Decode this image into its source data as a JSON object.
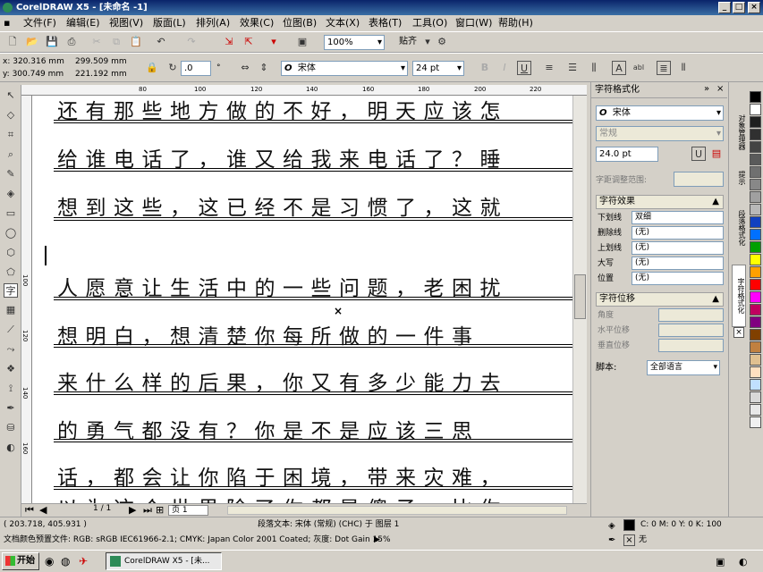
{
  "window": {
    "title": "CorelDRAW X5 - [未命名 -1]"
  },
  "menu": [
    "文件(F)",
    "编辑(E)",
    "视图(V)",
    "版面(L)",
    "排列(A)",
    "效果(C)",
    "位图(B)",
    "文本(X)",
    "表格(T)",
    "工具(O)",
    "窗口(W)",
    "帮助(H)"
  ],
  "toolbar": {
    "zoom": "100%",
    "snap_label": "贴齐"
  },
  "propbar": {
    "x": "x: 320.316 mm",
    "y": "y: 300.749 mm",
    "w": "299.509 mm",
    "h": "221.192 mm",
    "angle": ".0",
    "angle_unit": "°",
    "font": "宋体",
    "size": "24 pt",
    "italic_label": "I",
    "underline_label": "U",
    "align_label": "abl"
  },
  "canvas": {
    "lines": [
      "还有那些地方做的不好，明天应该怎",
      "给谁电话了，谁又给我来电话了？睡",
      "想到这些，这已经不是习惯了，这就",
      "",
      "人愿意让生活中的一些问题，老困扰",
      "想明白，想清楚你每所做的一件事",
      "来什么样的后果，你又有多少能力去",
      "的勇气都没有？你是不是应该三思",
      "话，都会让你陷于困境，带来灾难，",
      "以为这个世界除了你都是傻子，比你"
    ],
    "ruler_h": [
      "80",
      "100",
      "120",
      "140",
      "160",
      "180",
      "200",
      "220"
    ],
    "ruler_v": [
      "100",
      "120",
      "140",
      "160"
    ],
    "page_nav": "1 / 1",
    "page_tab": "页 1"
  },
  "docker": {
    "title": "字符格式化",
    "font": "宋体",
    "style": "常规",
    "size": "24.0 pt",
    "kerning_label": "字距调整范围:",
    "effects_title": "字符效果",
    "effects": [
      {
        "k": "下划线",
        "v": "双细"
      },
      {
        "k": "删除线",
        "v": "(无)"
      },
      {
        "k": "上划线",
        "v": "(无)"
      },
      {
        "k": "大写",
        "v": "(无)"
      },
      {
        "k": "位置",
        "v": "(无)"
      }
    ],
    "shift_title": "字符位移",
    "shift": [
      {
        "k": "角度"
      },
      {
        "k": "水平位移"
      },
      {
        "k": "垂直位移"
      }
    ],
    "script_label": "脚本:",
    "script_value": "全部语言"
  },
  "side_tabs": [
    "对象管理器",
    "提示",
    "段落格式化",
    "字符格式化"
  ],
  "palette": [
    "#000000",
    "#ffffff",
    "#1f1f1f",
    "#303030",
    "#444444",
    "#5a5a5a",
    "#707070",
    "#888888",
    "#a0a0a0",
    "#b8b8b8",
    "#1040c0",
    "#0070ff",
    "#00a000",
    "#ffff00",
    "#ffa000",
    "#ff0000",
    "#ff00ff",
    "#c00060",
    "#800080",
    "#804000",
    "#c08040",
    "#e0c090",
    "#ffe0c0",
    "#c0e0ff",
    "#d8d8d8",
    "#e8e8e8",
    "#f0f0f0"
  ],
  "status": {
    "coords": "( 203.718, 405.931 )",
    "object": "段落文本: 宋体 (常规) (CHC) 于 图层 1",
    "fill": "C: 0 M: 0 Y: 0 K: 100",
    "outline": "无",
    "color_profile": "文档颜色预置文件: RGB: sRGB IEC61966-2.1; CMYK: Japan Color 2001 Coated; 灰度: Dot Gain 15%"
  },
  "taskbar": {
    "start": "开始",
    "task": "CorelDRAW X5 - [未..."
  }
}
